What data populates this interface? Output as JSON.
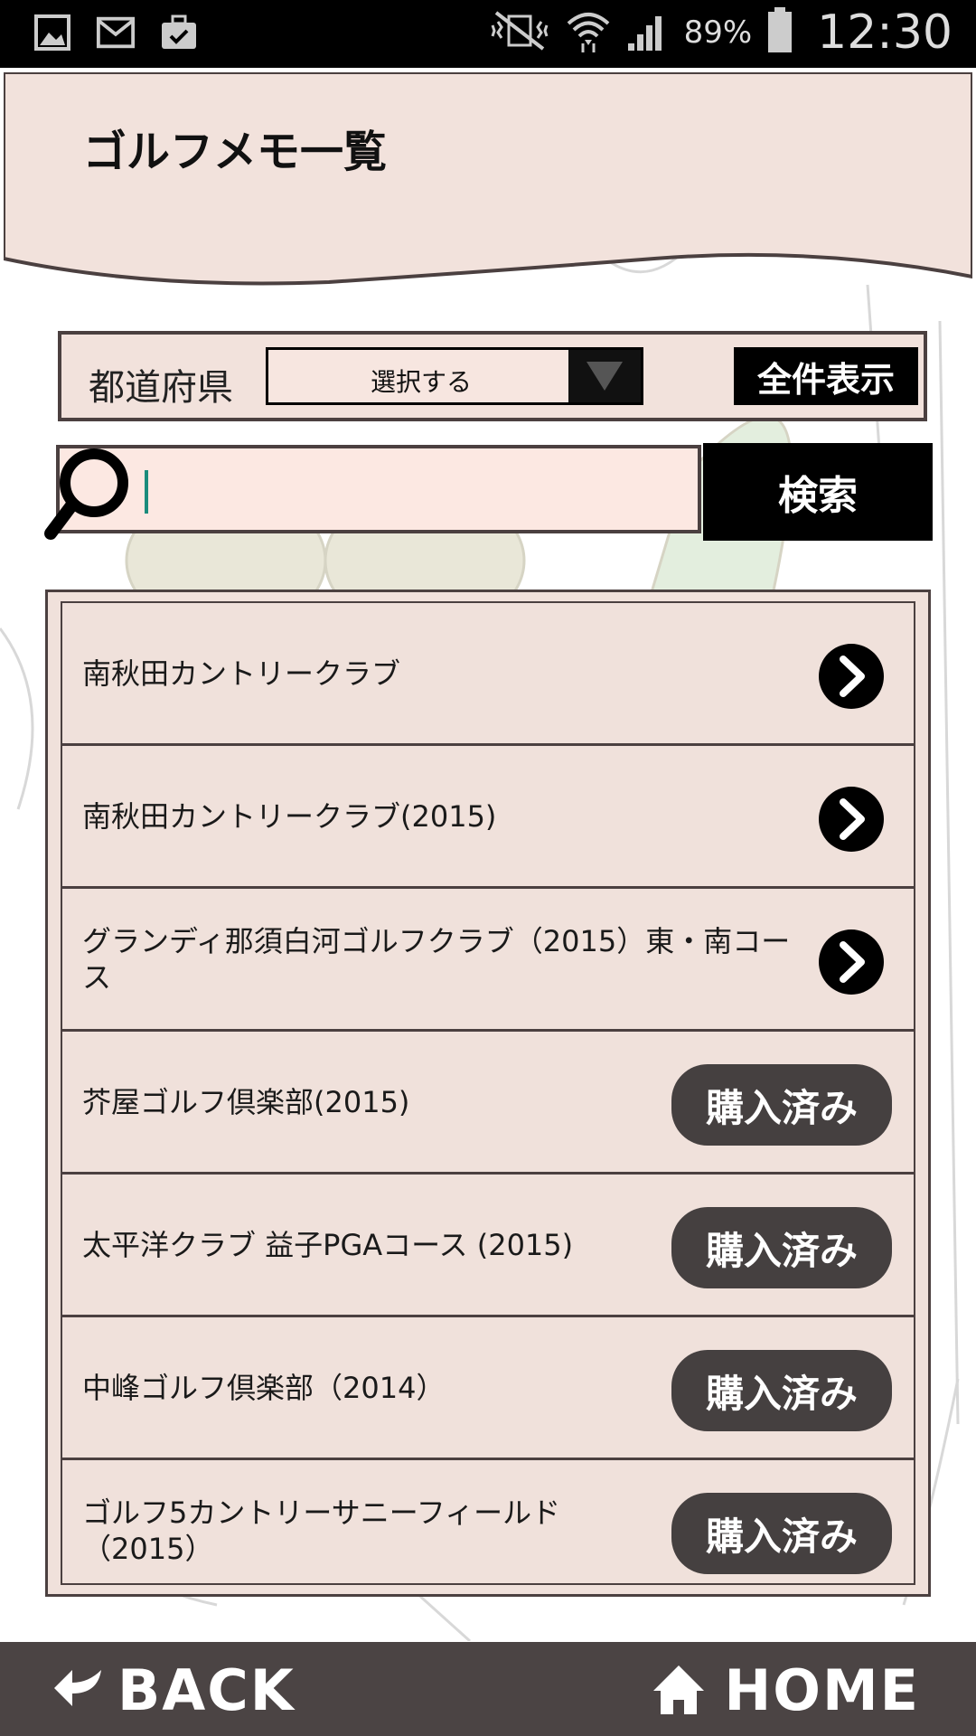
{
  "status_bar": {
    "battery_percent": "89%",
    "time": "12:30",
    "left_icons": [
      "gallery-icon",
      "gmail-icon",
      "briefcase-icon"
    ],
    "right_icons": [
      "vibrate-icon",
      "wifi-icon",
      "signal-icon",
      "battery-icon"
    ]
  },
  "header": {
    "title": "ゴルフメモ一覧"
  },
  "filter": {
    "prefecture_label": "都道府県",
    "select_value": "選択する",
    "show_all_label": "全件表示"
  },
  "search": {
    "value": "",
    "button_label": "検索"
  },
  "courses": [
    {
      "name": "南秋田カントリークラブ",
      "action": "arrow"
    },
    {
      "name": "南秋田カントリークラブ(2015)",
      "action": "arrow"
    },
    {
      "name": "グランディ那須白河ゴルフクラブ（2015）東・南コース",
      "action": "arrow"
    },
    {
      "name": "芥屋ゴルフ倶楽部(2015)",
      "action": "purchased",
      "action_label": "購入済み"
    },
    {
      "name": "太平洋クラブ 益子PGAコース (2015)",
      "action": "purchased",
      "action_label": "購入済み"
    },
    {
      "name": "中峰ゴルフ倶楽部（2014）",
      "action": "purchased",
      "action_label": "購入済み"
    },
    {
      "name": "ゴルフ5カントリーサニーフィールド（2015）",
      "action": "purchased",
      "action_label": "購入済み"
    }
  ],
  "bottom_bar": {
    "back_label": "BACK",
    "home_label": "HOME"
  },
  "colors": {
    "header_bg": "#f2e2dc",
    "list_bg": "#f0e1db",
    "border": "#4b4040",
    "bottom_bar": "#4b4444",
    "purchased_btn": "#454040"
  }
}
